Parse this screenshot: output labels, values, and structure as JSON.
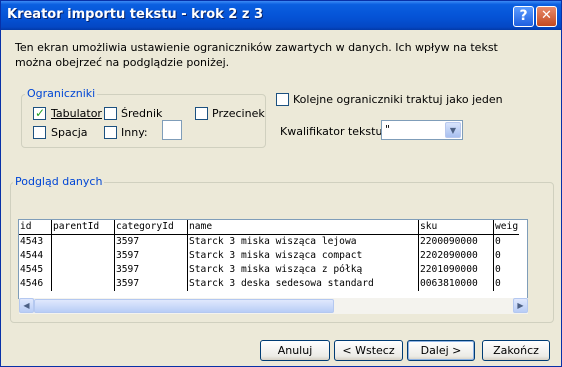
{
  "window": {
    "title": "Kreator importu tekstu - krok 2 z 3",
    "help_glyph": "?",
    "close_glyph": "✕"
  },
  "description": "Ten ekran umożliwia ustawienie ograniczników zawartych w danych. Ich wpływ na tekst można obejrzeć na podglądzie poniżej.",
  "delimiters": {
    "legend": "Ograniczniki",
    "tab": {
      "label": "Tabulator",
      "checked": true
    },
    "semicolon": {
      "label": "Średnik",
      "checked": false
    },
    "comma": {
      "label": "Przecinek",
      "checked": false
    },
    "space": {
      "label": "Spacja",
      "checked": false
    },
    "other": {
      "label": "Inny:",
      "checked": false,
      "value": ""
    }
  },
  "consecutive": {
    "label": "Kolejne ograniczniki traktuj jako jeden",
    "checked": false
  },
  "qualifier": {
    "label": "Kwalifikator tekstu:",
    "value": "\""
  },
  "preview": {
    "legend": "Podgląd danych",
    "columns": [
      "id",
      "parentId",
      "categoryId",
      "name",
      "sku",
      "weig"
    ],
    "rows": [
      [
        "4543",
        "",
        "3597",
        "Starck 3 miska wisząca lejowa",
        "2200090000",
        "0"
      ],
      [
        "4544",
        "",
        "3597",
        "Starck 3 miska wisząca compact",
        "2202090000",
        "0"
      ],
      [
        "4545",
        "",
        "3597",
        "Starck 3 miska wisząca z półką",
        "2201090000",
        "0"
      ],
      [
        "4546",
        "",
        "3597",
        "Starck 3 deska sedesowa standard",
        "0063810000",
        "0"
      ]
    ]
  },
  "buttons": {
    "cancel": "Anuluj",
    "back": "< Wstecz",
    "next": "Dalej >",
    "finish": "Zakończ"
  },
  "colors": {
    "titlebar": "#0553d6",
    "dialog_bg": "#ece9d8",
    "group_label": "#0046d5",
    "check": "#21a121"
  }
}
